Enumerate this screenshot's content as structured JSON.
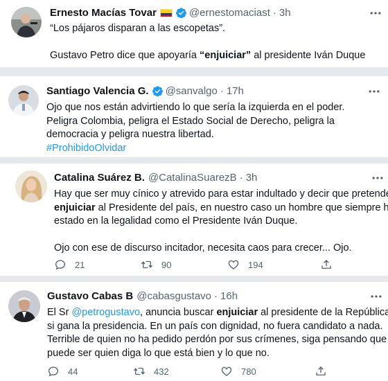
{
  "tweets": [
    {
      "name": "Ernesto Macías Tovar",
      "handle": "@ernestomaciast",
      "dot": "·",
      "time": "3h",
      "lines": [
        [
          {
            "t": "“Los pájaros disparan a las escopetas”."
          }
        ],
        [],
        [
          {
            "t": "Gustavo Petro dice que apoyaría "
          },
          {
            "t": "“enjuiciar”",
            "b": true
          },
          {
            "t": " al presidente Iván Duque"
          }
        ]
      ]
    },
    {
      "name": "Santiago Valencia G.",
      "handle": "@sanvalgo",
      "dot": "·",
      "time": "17h",
      "lines": [
        [
          {
            "t": "Ojo que nos están advirtiendo lo que sería la izquierda en el poder."
          }
        ],
        [
          {
            "t": "Peligra Colombia, peligra el Estado Social de Derecho, peligra la"
          }
        ],
        [
          {
            "t": "democracia y peligra nuestra libertad."
          }
        ],
        [
          {
            "t": "#ProhibidoOlvidar",
            "link": true
          }
        ]
      ]
    },
    {
      "name": "Catalina Suárez B.",
      "handle": "@CatalinaSuarezB",
      "dot": "·",
      "time": "3h",
      "lines": [
        [
          {
            "t": "Hay que ser muy cínico y atrevido para estar indultado y decir que pretende"
          }
        ],
        [
          {
            "t": "enjuiciar",
            "b": true
          },
          {
            "t": " al Presidente del país, en nuestro caso un hombre que siempre ha"
          }
        ],
        [
          {
            "t": "estado en la legalidad como el Presidente Iván Duque."
          }
        ],
        [],
        [
          {
            "t": "Ojo con ese de discurso incitador, necesita caos para crecer... Ojo."
          }
        ]
      ],
      "replies": "21",
      "retweets": "90",
      "likes": "194"
    },
    {
      "name": "Gustavo Cabas B",
      "handle": "@cabasgustavo",
      "dot": "·",
      "time": "16h",
      "lines": [
        [
          {
            "t": "El Sr "
          },
          {
            "t": "@petrogustavo",
            "link": true
          },
          {
            "t": ", anuncia buscar "
          },
          {
            "t": "enjuiciar",
            "b": true
          },
          {
            "t": " al presidente de la República"
          }
        ],
        [
          {
            "t": "si gana la presidencia. En un país con dignidad, no fuera candidato a nada."
          }
        ],
        [
          {
            "t": "Terrible de quien no ha pedido perdón por sus crímenes, siga pensando que"
          }
        ],
        [
          {
            "t": "puede ser quien diga lo que está bien y lo que no."
          }
        ]
      ],
      "replies": "44",
      "retweets": "432",
      "likes": "780"
    }
  ],
  "icons": {
    "verified": "verified-badge-icon",
    "flag": "colombia-flag-icon",
    "more": "more-options-icon",
    "reply": "reply-icon",
    "retweet": "retweet-icon",
    "like": "like-icon",
    "share": "share-icon"
  },
  "colors": {
    "link": "#1d9bf0",
    "secondary_text": "#536471",
    "separator_background": "#e6e9ec"
  }
}
